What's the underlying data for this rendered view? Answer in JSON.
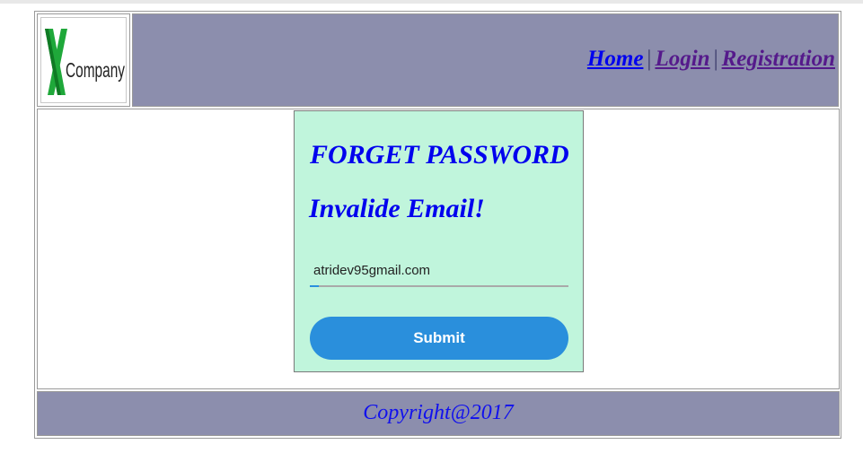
{
  "logo": {
    "text": "Company",
    "mark": "X"
  },
  "nav": {
    "items": [
      {
        "label": "Home"
      },
      {
        "label": "Login"
      },
      {
        "label": "Registration"
      }
    ],
    "separator": "|"
  },
  "form": {
    "title": "FORGET PASSWORD",
    "error": "Invalide Email!",
    "email_value": "atridev95gmail.com",
    "submit_label": "Submit"
  },
  "footer": {
    "copyright": "Copyright@2017"
  },
  "colors": {
    "header_bg": "#8c8ead",
    "form_bg": "#c0f5dc",
    "button_bg": "#2a8fdc",
    "link": "#0000ee",
    "visited_link": "#551a8b",
    "logo_green": "#1fa83a"
  }
}
